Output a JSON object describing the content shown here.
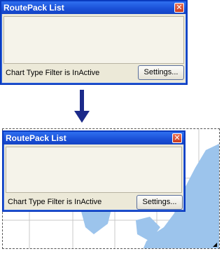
{
  "top_window": {
    "title": "RoutePack List",
    "close_glyph": "✕",
    "status_text": "Chart Type Filter is InActive",
    "settings_label": "Settings..."
  },
  "arrow": {
    "icon": "arrow-down-icon",
    "color": "#1c2a8a"
  },
  "bottom_window": {
    "title": "RoutePack List",
    "close_glyph": "✕",
    "status_text": "Chart Type Filter is InActive",
    "settings_label": "Settings..."
  },
  "map": {
    "water_color": "#9cc4ec",
    "grid_color": "#c8c8c8",
    "grip_glyph": "◢"
  },
  "colors": {
    "title_bar": "#1a4fd6",
    "window_body": "#ece9d8",
    "close_button": "#c93a1c"
  }
}
